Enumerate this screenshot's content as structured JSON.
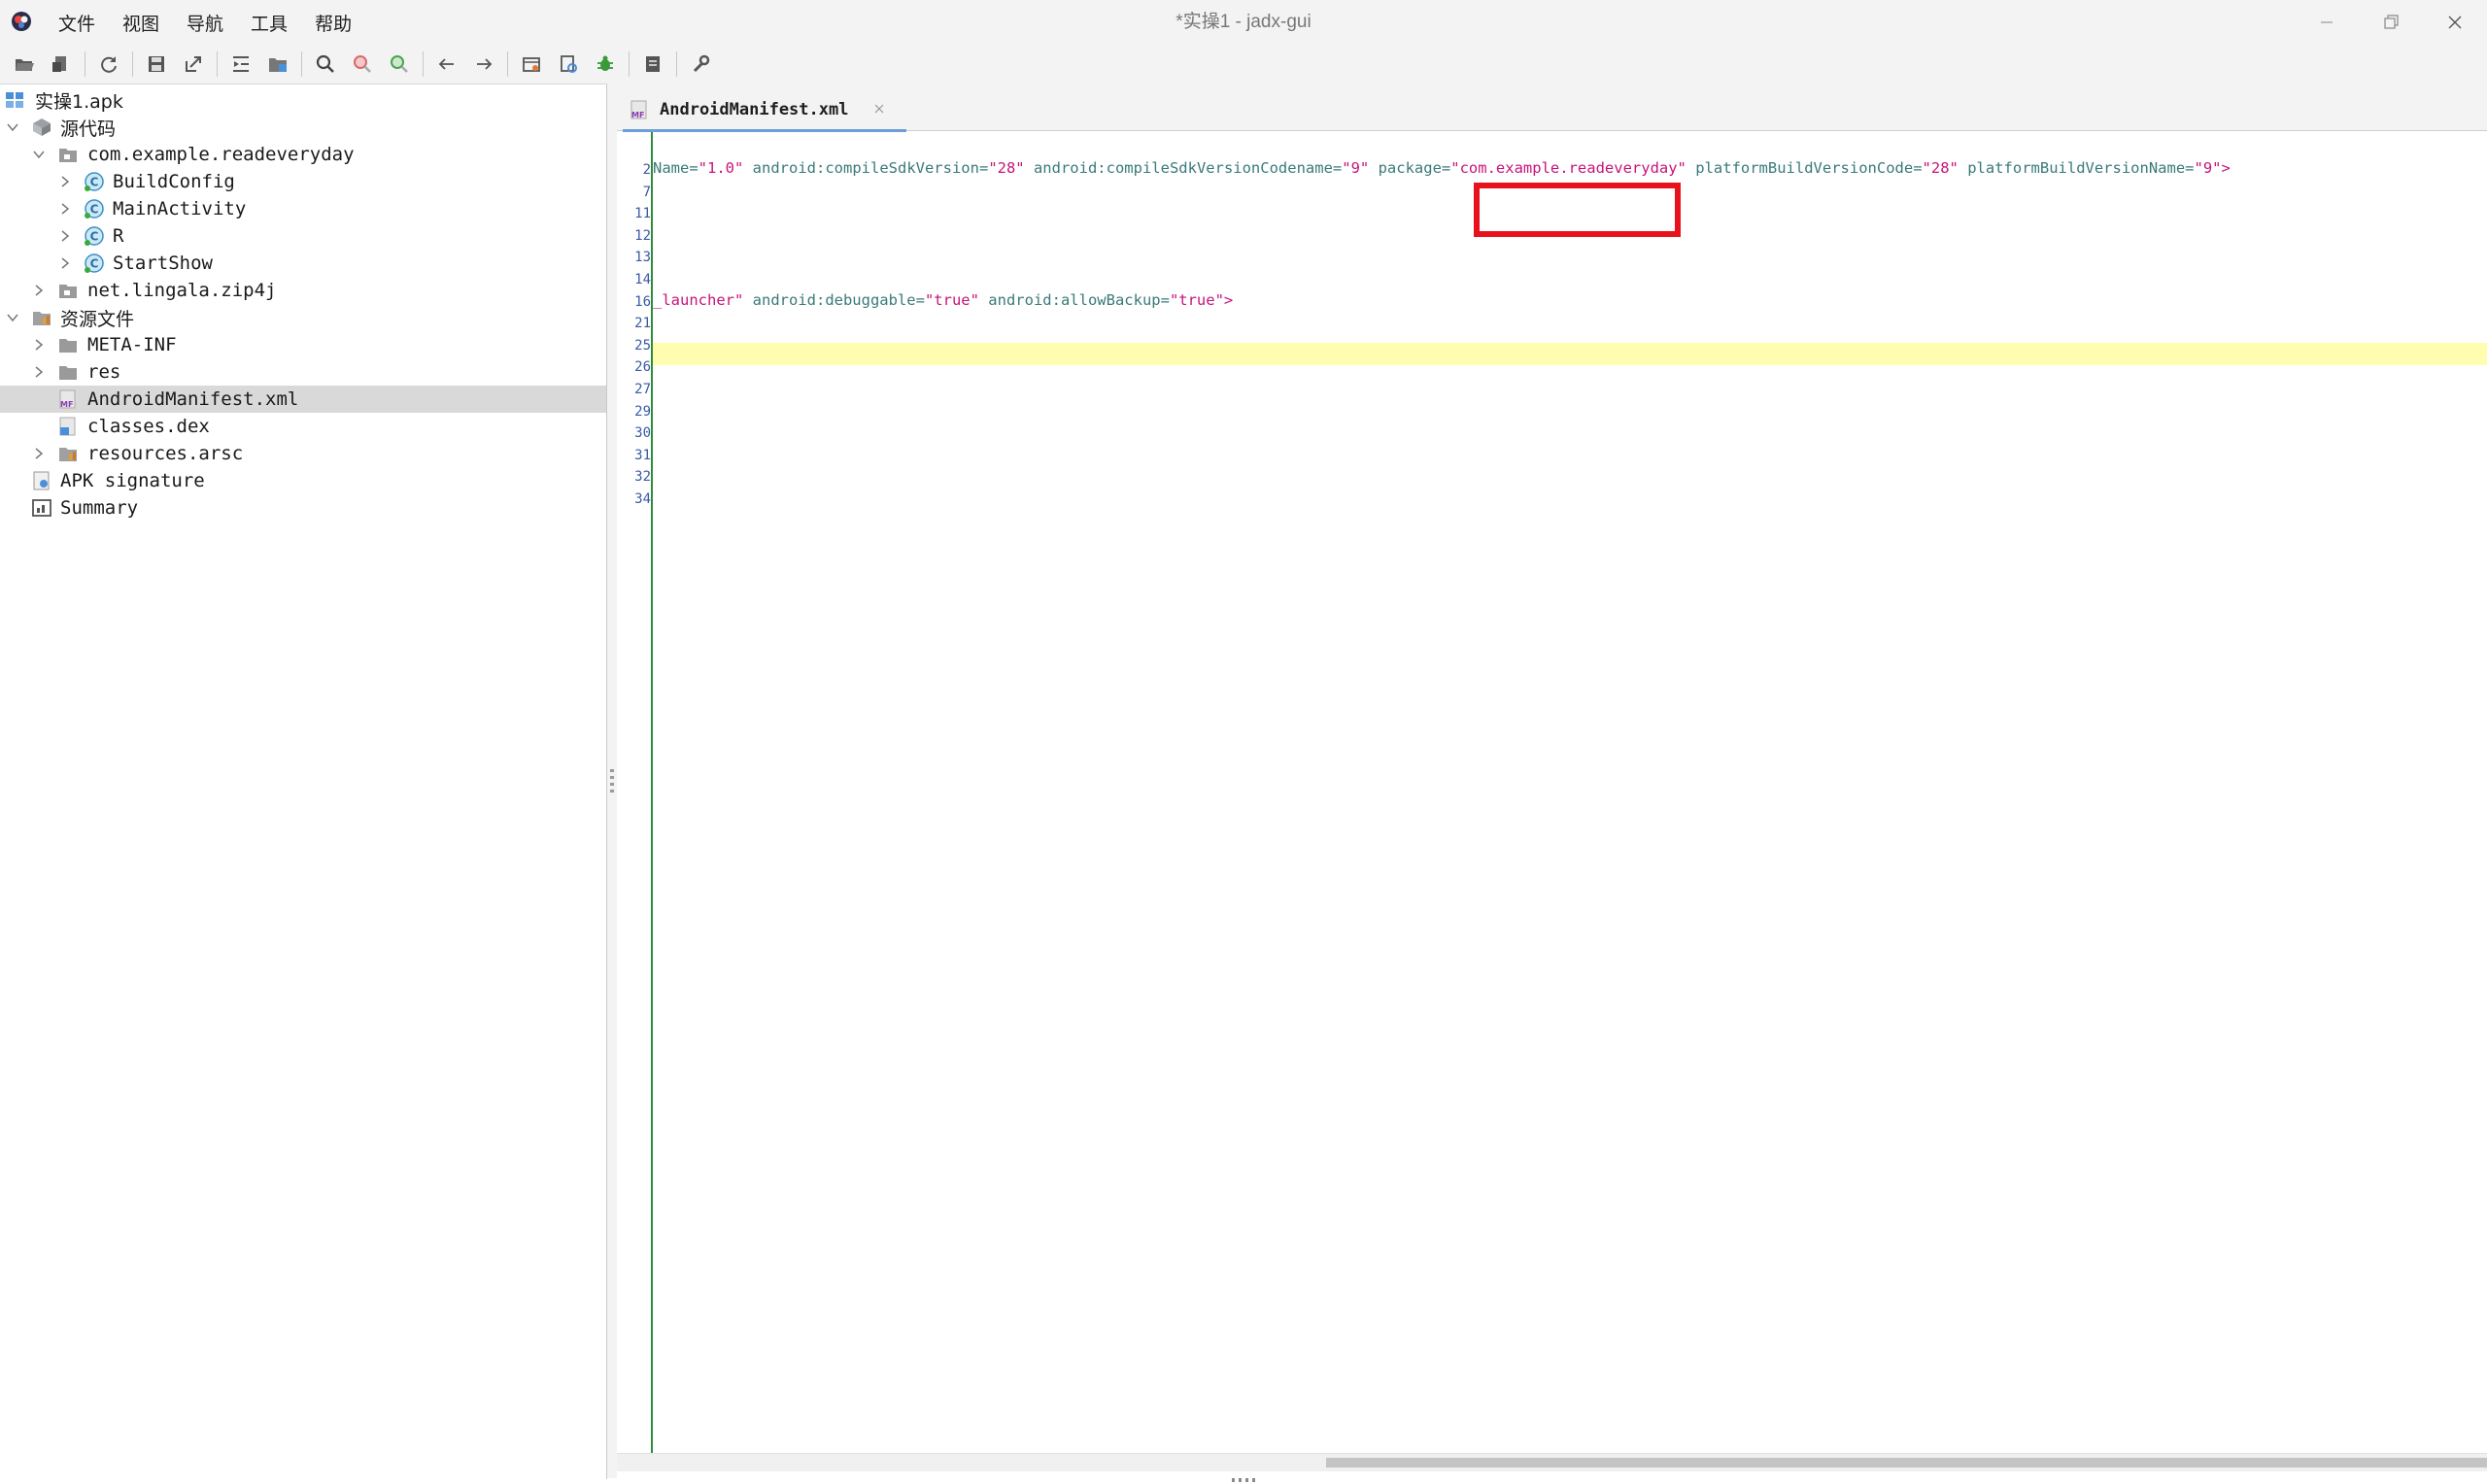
{
  "window": {
    "title": "*实操1 - jadx-gui",
    "menu": [
      "文件",
      "视图",
      "导航",
      "工具",
      "帮助"
    ]
  },
  "toolbar": {
    "buttons": [
      "open-file",
      "add-files",
      "reload",
      "save-all",
      "export",
      "sync-editor",
      "flatten-packages",
      "text-search",
      "class-search",
      "usage-search",
      "back",
      "forward",
      "deobfuscation",
      "quark-analysis",
      "debugger",
      "log-viewer",
      "preferences"
    ]
  },
  "tree": {
    "root": "实操1.apk",
    "source_code": "源代码",
    "package": "com.example.readeveryday",
    "classes": [
      "BuildConfig",
      "MainActivity",
      "R",
      "StartShow"
    ],
    "zip_package": "net.lingala.zip4j",
    "resources": "资源文件",
    "meta_inf": "META-INF",
    "res": "res",
    "manifest": "AndroidManifest.xml",
    "classes_dex": "classes.dex",
    "resources_arsc": "resources.arsc",
    "apk_signature": "APK signature",
    "summary": "Summary"
  },
  "editor": {
    "tab_label": "AndroidManifest.xml",
    "line_numbers": [
      "2",
      "7",
      "11",
      "12",
      "13",
      "14",
      "16",
      "21",
      "25",
      "26",
      "27",
      "29",
      "30",
      "31",
      "32",
      "34"
    ],
    "line2": {
      "a1": "Name=",
      "v1": "\"1.0\"",
      "a2": " android:compileSdkVersion=",
      "v2": "\"28\"",
      "a3": " android:compileSdkVersionCodename=",
      "v3": "\"9\"",
      "a4": " package=",
      "v4": "\"com.example.readeveryday\"",
      "a5": " platformBuildVersionCode=",
      "v5": "\"28\"",
      "a6": " platformBuildVersionName=",
      "v6": "\"9\">"
    },
    "line16": {
      "v0": "_launcher\"",
      "a1": " android:debuggable=",
      "v1": "\"true\"",
      "a2": " android:allowBackup=",
      "v2": "\"true\">"
    }
  },
  "colors": {
    "xml_attribute": "#3a7a7a",
    "xml_value": "#c8147a",
    "line_highlight": "#fefdb0",
    "annotation_red": "#e8121c",
    "gutter_green": "#2e8b3a"
  }
}
